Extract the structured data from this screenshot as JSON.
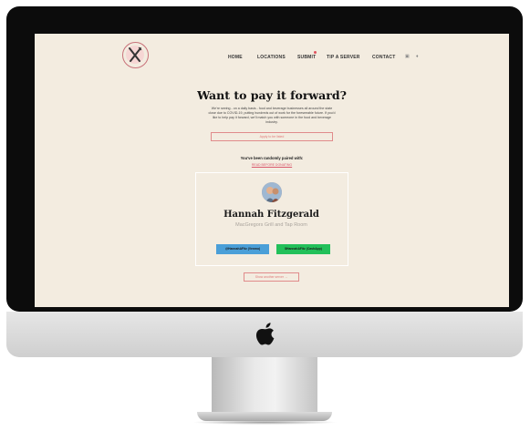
{
  "nav": {
    "items": [
      "HOME",
      "LOCATIONS",
      "SUBMIT",
      "TIP A SERVER",
      "CONTACT"
    ],
    "social": [
      "instagram-icon",
      "twitter-icon"
    ]
  },
  "main": {
    "title": "Want to pay it forward?",
    "intro": "We're seeing - on a daily basis - food and beverage businesses all around the state close due to COVID-19, putting hundreds out of work for the foreseeable future. If you'd like to help pay it forward, we'll match you with someone in the food and beverage industry.",
    "apply_label": "Apply to be listed",
    "paired_label": "You've been randomly paired with:",
    "paired_link": "READ BEFORE DONATING"
  },
  "card": {
    "name": "Hannah Fitzgerald",
    "workplace": "MacGregors Grill and Tap Room",
    "venmo_label": "@HannahAFitz (Venmo)",
    "cash_label": "$HannahAFitz (CashApp)"
  },
  "another_label": "Show another server →",
  "colors": {
    "accent": "#e07a7a",
    "venmo": "#4a9fd8",
    "cashapp": "#22c05a",
    "page_bg": "#f3ece0"
  }
}
